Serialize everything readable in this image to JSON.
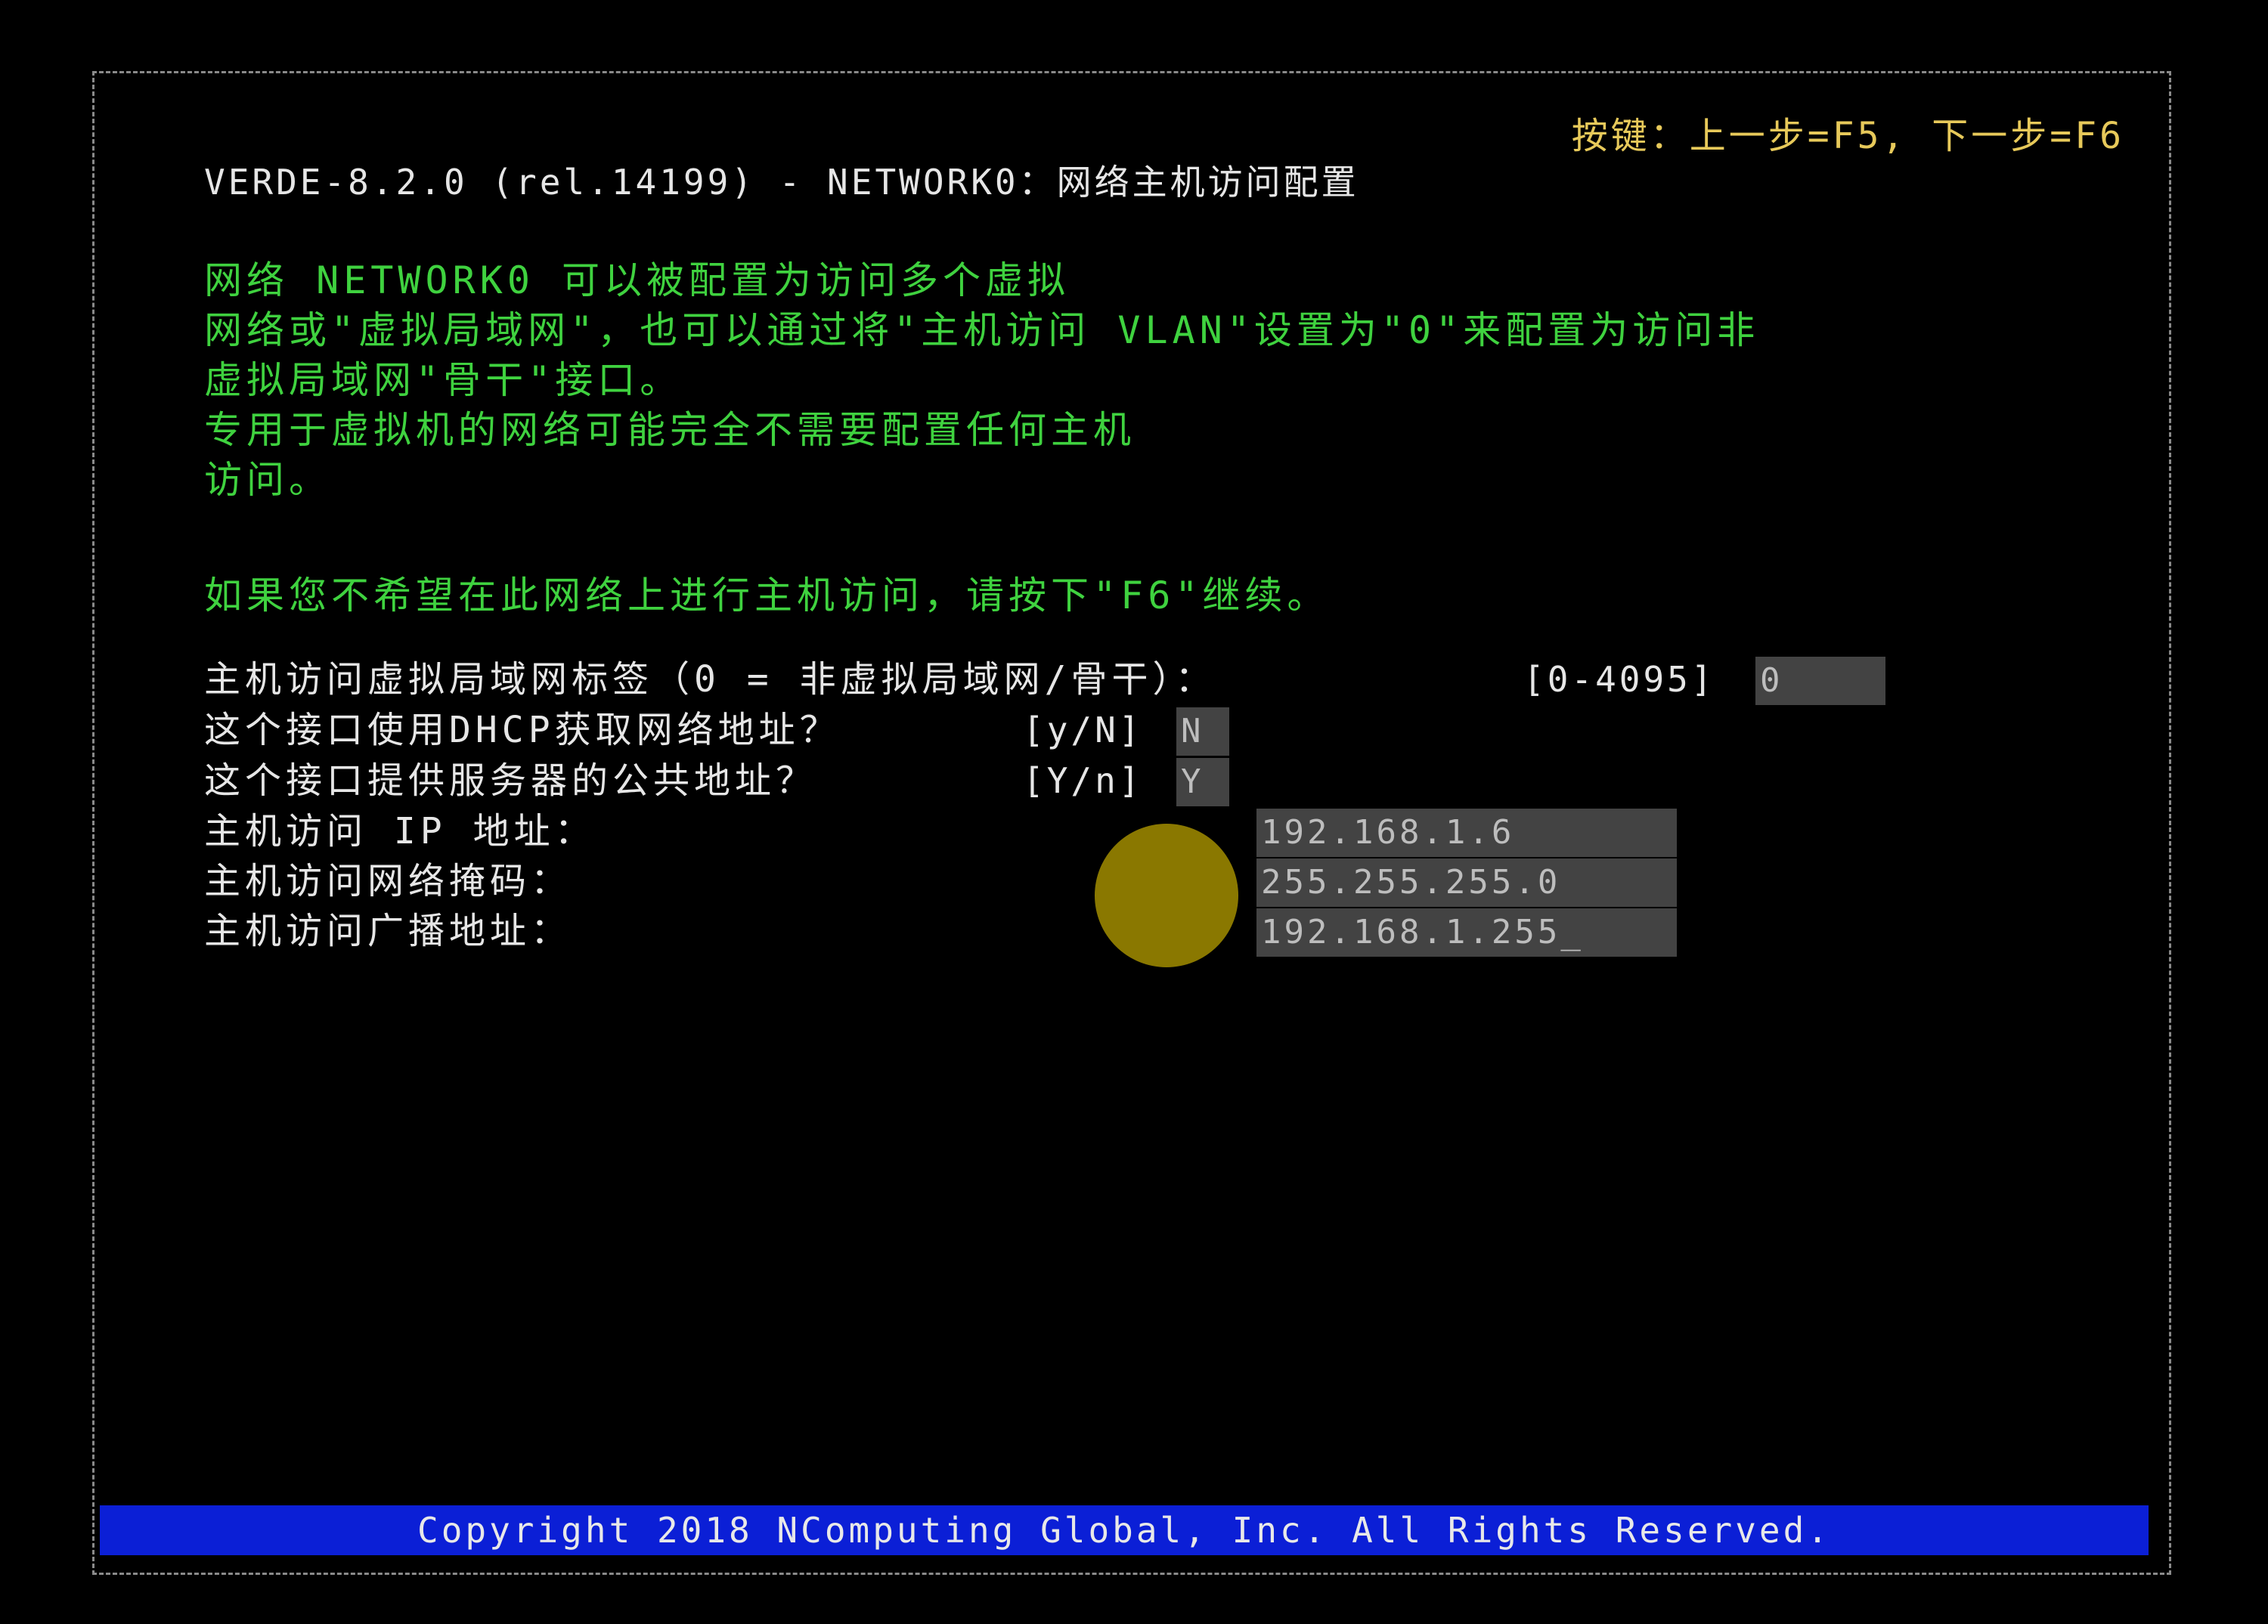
{
  "header": {
    "hint": "按键：上一步=F5, 下一步=F6",
    "title": "VERDE-8.2.0 (rel.14199) - NETWORK0：网络主机访问配置"
  },
  "description": {
    "lines": [
      "网络 NETWORK0 可以被配置为访问多个虚拟",
      "网络或\"虚拟局域网\"，也可以通过将\"主机访问 VLAN\"设置为\"0\"来配置为访问非",
      "虚拟局域网\"骨干\"接口。",
      "专用于虚拟机的网络可能完全不需要配置任何主机",
      "访问。"
    ],
    "skip_note": "如果您不希望在此网络上进行主机访问，请按下\"F6\"继续。"
  },
  "form": {
    "vlan": {
      "label": "主机访问虚拟局域网标签（0 = 非虚拟局域网/骨干）：",
      "range": "[0-4095]",
      "value": "0"
    },
    "dhcp": {
      "label": "这个接口使用DHCP获取网络地址？",
      "range": "[y/N]",
      "value": "N"
    },
    "public": {
      "label": "这个接口提供服务器的公共地址？",
      "range": "[Y/n]",
      "value": "Y"
    },
    "ip": {
      "label": "主机访问 IP 地址：",
      "value": "192.168.1.6"
    },
    "netmask": {
      "label": "主机访问网络掩码：",
      "value": "255.255.255.0"
    },
    "broadcast": {
      "label": "主机访问广播地址：",
      "value": "192.168.1.255_"
    }
  },
  "footer": {
    "copyright": "Copyright 2018 NComputing Global, Inc.  All Rights Reserved."
  },
  "colors": {
    "background": "#000000",
    "hint": "#e7c95a",
    "info_text": "#3fd23f",
    "footer_bar": "#0b1fd6",
    "cursor_indicator": "#8a7800"
  }
}
